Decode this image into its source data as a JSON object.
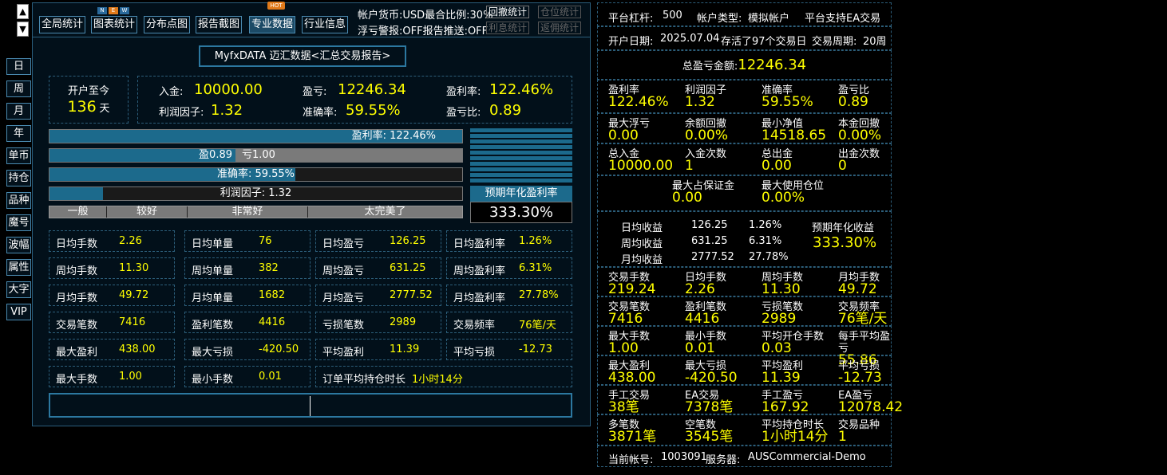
{
  "sidebar": {
    "up": "▲",
    "down": "▼",
    "items": [
      "日",
      "周",
      "月",
      "年",
      "单币",
      "持仓",
      "品种",
      "魔号",
      "波幅",
      "属性",
      "大字",
      "VIP"
    ]
  },
  "nav": {
    "buttons": [
      "全局统计",
      "图表统计",
      "分布点图",
      "报告截图",
      "专业数据",
      "行业信息"
    ],
    "new_badge": [
      "N",
      "E",
      "W"
    ],
    "hot_badge": "HOT",
    "info1": "帐户货币:USD最合比例:30%",
    "info2": "浮亏警报:OFF报告推送:OFF",
    "links": [
      "回撤统计",
      "仓位统计",
      "利息统计",
      "返佣统计"
    ]
  },
  "report_title": "MyfxDATA 迈汇数据<汇总交易报告>",
  "summary": {
    "since_label": "开户至今",
    "days": "136",
    "days_unit": "天",
    "deposit_l": "入金:",
    "deposit_v": "10000.00",
    "profit_l": "盈亏:",
    "profit_v": "12246.34",
    "roi_l": "盈利率:",
    "roi_v": "122.46%",
    "pf_l": "利润因子:",
    "pf_v": "1.32",
    "acc_l": "准确率:",
    "acc_v": "59.55%",
    "ratio_l": "盈亏比:",
    "ratio_v": "0.89"
  },
  "bars": {
    "roi": "盈利率:  122.46%",
    "win": "盈0.89",
    "loss": "亏1.00",
    "acc": "准确率:  59.55%",
    "pf": "利润因子:  1.32",
    "scale": [
      "一般",
      "较好",
      "非常好",
      "太完美了"
    ],
    "annual_label": "预期年化盈利率",
    "annual_value": "333.30%",
    "roi_fill": 1.0,
    "acc_fill": 0.5955,
    "pf_fill": 0.13
  },
  "stats": [
    [
      [
        "日均手数",
        "2.26"
      ],
      [
        "日均单量",
        "76"
      ],
      [
        "日均盈亏",
        "126.25"
      ],
      [
        "日均盈利率",
        "1.26%"
      ]
    ],
    [
      [
        "周均手数",
        "11.30"
      ],
      [
        "周均单量",
        "382"
      ],
      [
        "周均盈亏",
        "631.25"
      ],
      [
        "周均盈利率",
        "6.31%"
      ]
    ],
    [
      [
        "月均手数",
        "49.72"
      ],
      [
        "月均单量",
        "1682"
      ],
      [
        "月均盈亏",
        "2777.52"
      ],
      [
        "月均盈利率",
        "27.78%"
      ]
    ],
    [
      [
        "交易笔数",
        "7416"
      ],
      [
        "盈利笔数",
        "4416"
      ],
      [
        "亏损笔数",
        "2989"
      ],
      [
        "交易频率",
        "76笔/天"
      ]
    ],
    [
      [
        "最大盈利",
        "438.00"
      ],
      [
        "最大亏损",
        "-420.50"
      ],
      [
        "平均盈利",
        "11.39"
      ],
      [
        "平均亏损",
        "-12.73"
      ]
    ]
  ],
  "stats_last": [
    [
      "最大手数",
      "1.00"
    ],
    [
      "最小手数",
      "0.01"
    ],
    [
      "订单平均持仓时长",
      "1小时14分"
    ]
  ],
  "right": {
    "r1": [
      "平台杠杆:",
      "500",
      "帐户类型:",
      "模拟帐户",
      "平台支持EA交易"
    ],
    "r2": [
      "开户日期:",
      "2025.07.04",
      "存活了97个交易日",
      "交易周期:",
      "20周"
    ],
    "total_label": "总盈亏金额:",
    "total_value": "12246.34",
    "g1": [
      [
        "盈利率",
        "122.46%"
      ],
      [
        "利润因子",
        "1.32"
      ],
      [
        "准确率",
        "59.55%"
      ],
      [
        "盈亏比",
        "0.89"
      ]
    ],
    "g2": [
      [
        "最大浮亏",
        "0.00"
      ],
      [
        "余额回撤",
        "0.00%"
      ],
      [
        "最小净值",
        "14518.65"
      ],
      [
        "本金回撤",
        "0.00%"
      ]
    ],
    "g3": [
      [
        "总入金",
        "10000.00"
      ],
      [
        "入金次数",
        "1"
      ],
      [
        "总出金",
        "0.00"
      ],
      [
        "出金次数",
        "0"
      ]
    ],
    "g4": [
      [
        "最大占保证金",
        "0.00"
      ],
      [
        "最大使用仓位",
        "0.00%"
      ]
    ],
    "income": [
      [
        "日均收益",
        "126.25",
        "1.26%"
      ],
      [
        "周均收益",
        "631.25",
        "6.31%"
      ],
      [
        "月均收益",
        "2777.52",
        "27.78%"
      ]
    ],
    "annual_label": "预期年化收益",
    "annual_value": "333.30%",
    "g5": [
      [
        "交易手数",
        "219.24"
      ],
      [
        "日均手数",
        "2.26"
      ],
      [
        "周均手数",
        "11.30"
      ],
      [
        "月均手数",
        "49.72"
      ]
    ],
    "g6": [
      [
        "交易笔数",
        "7416"
      ],
      [
        "盈利笔数",
        "4416"
      ],
      [
        "亏损笔数",
        "2989"
      ],
      [
        "交易频率",
        "76笔/天"
      ]
    ],
    "g7": [
      [
        "最大手数",
        "1.00"
      ],
      [
        "最小手数",
        "0.01"
      ],
      [
        "平均开仓手数",
        "0.03"
      ],
      [
        "每手平均盈亏",
        "55.86"
      ]
    ],
    "g8": [
      [
        "最大盈利",
        "438.00"
      ],
      [
        "最大亏损",
        "-420.50"
      ],
      [
        "平均盈利",
        "11.39"
      ],
      [
        "平均亏损",
        "-12.73"
      ]
    ],
    "g9": [
      [
        "手工交易",
        "38笔"
      ],
      [
        "EA交易",
        "7378笔"
      ],
      [
        "手工盈亏",
        "167.92"
      ],
      [
        "EA盈亏",
        "12078.42"
      ]
    ],
    "g10": [
      [
        "多笔数",
        "3871笔"
      ],
      [
        "空笔数",
        "3545笔"
      ],
      [
        "平均持仓时长",
        "1小时14分"
      ],
      [
        "交易品种",
        "1"
      ]
    ],
    "account_l": "当前帐号:",
    "account_v": "1003091",
    "server_l": "服务器:",
    "server_v": "AUSCommercial-Demo"
  }
}
